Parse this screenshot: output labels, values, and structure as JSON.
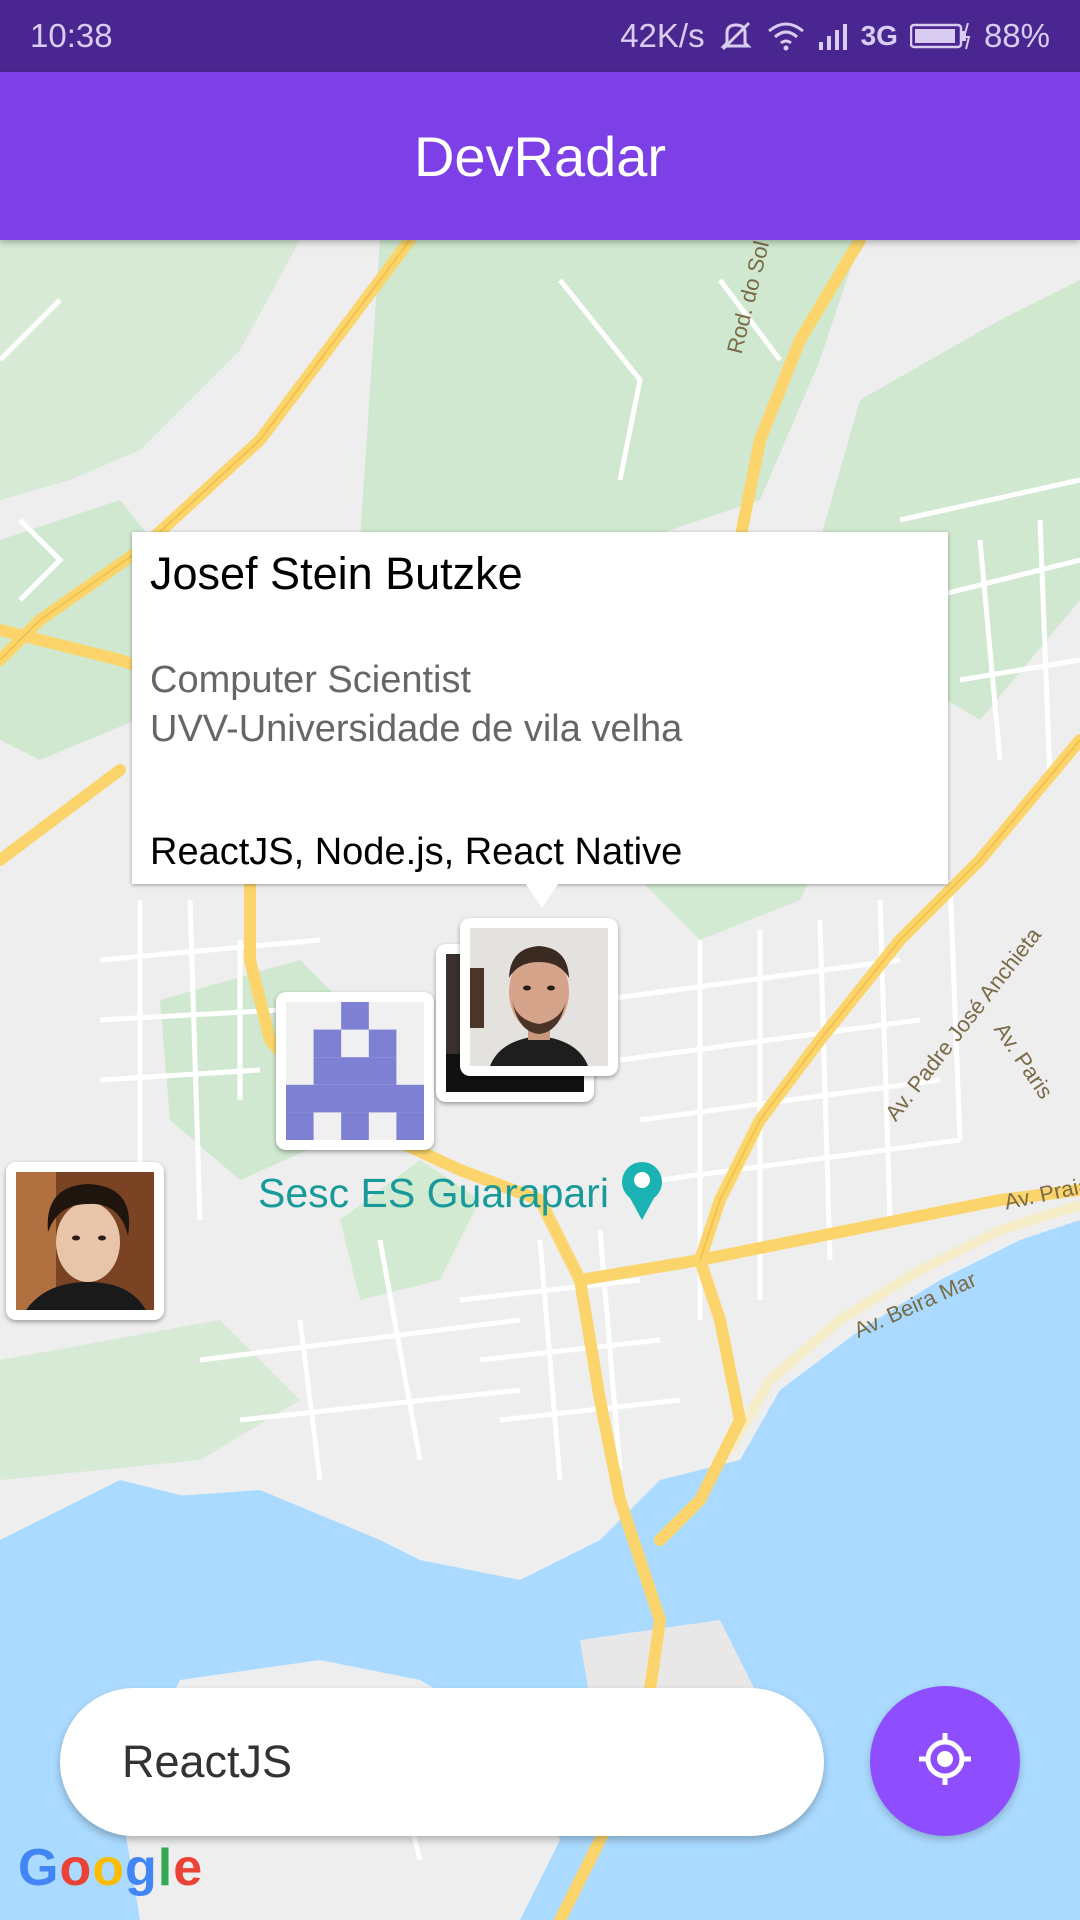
{
  "status_bar": {
    "time": "10:38",
    "speed": "42K/s",
    "network": "3G",
    "battery": "88%",
    "icons": [
      "mute-icon",
      "wifi-icon",
      "signal-icon",
      "battery-icon"
    ]
  },
  "app": {
    "title": "DevRadar",
    "primary_color": "#7d40e7",
    "accent_color": "#8e4dff"
  },
  "map": {
    "poi_label": "Sesc ES Guarapari",
    "roads": [
      "Rod. do Sol",
      "Av. Padre José Anchieta",
      "Av. Paris",
      "Av. Praia",
      "Av. Beira Mar"
    ]
  },
  "callout": {
    "name": "Josef Stein Butzke",
    "bio_line1": "Computer Scientist",
    "bio_line2": "UVV-Universidade de vila velha",
    "techs": "ReactJS, Node.js, React Native"
  },
  "search": {
    "value": "ReactJS"
  },
  "attribution": {
    "logo_text": "Google"
  }
}
